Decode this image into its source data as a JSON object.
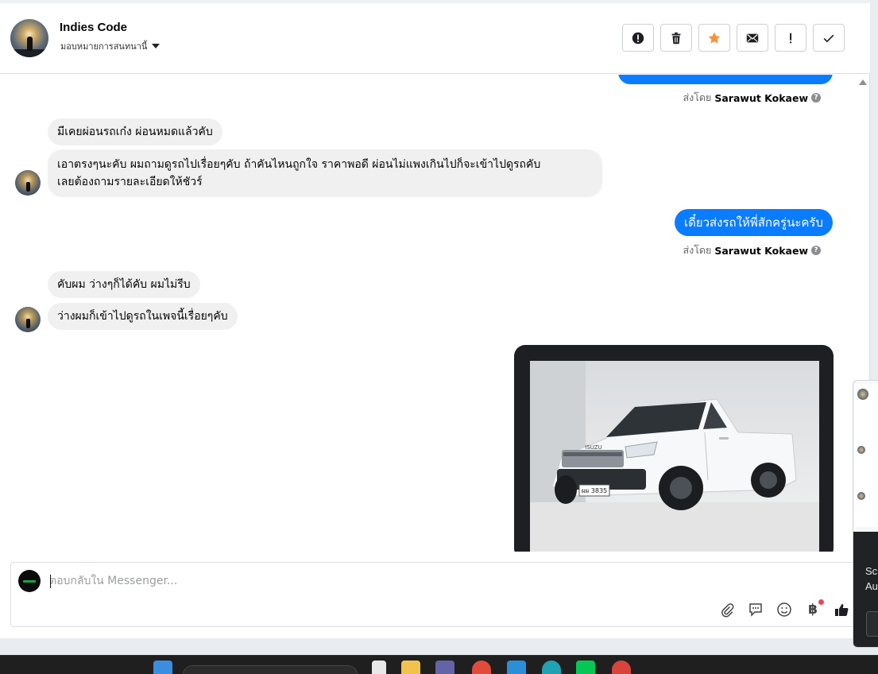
{
  "header": {
    "contact_name": "Indies Code",
    "assign_label": "มอบหมายการสนทนานี้",
    "actions": [
      {
        "id": "spam",
        "icon": "alert-circle-icon"
      },
      {
        "id": "delete",
        "icon": "trash-icon"
      },
      {
        "id": "star",
        "icon": "star-icon",
        "color": "#f7923a"
      },
      {
        "id": "unread",
        "icon": "envelope-icon"
      },
      {
        "id": "important",
        "icon": "exclamation-icon"
      },
      {
        "id": "done",
        "icon": "check-icon"
      }
    ]
  },
  "messages": {
    "sent_by_prefix": "ส่งโดย",
    "sender_name": "Sarawut Kokaew",
    "m1": "มีเคยผ่อนรถเก๋ง  ผ่อนหมดแล้วคับ",
    "m2_line1": "เอาตรงๆนะคับ  ผมถามดูรถไปเรื่อยๆคับ ถ้าคันไหนถูกใจ  ราคาพอดี ผ่อนไม่แพงเกินไปก็จะเข้าไปดูรถคับ",
    "m2_line2": "เลยต้องถามรายละเอียดให้ชัวร์",
    "m3": "เดี๋ยวส่งรถให้พี่สักครู่นะครับ",
    "m4": "คับผม ว่างๆก็ได้คับ  ผมไม่รีบ",
    "m5": "ว่างผมก็เข้าไปดูรถในเพจนี้เรื่อยๆคับ",
    "plate": "ผผ 3835",
    "car_brand": "ISUZU"
  },
  "reply": {
    "placeholder": "ตอบกลับใน Messenger...",
    "baht_symbol": "฿"
  },
  "popup": {
    "text1": "Sc",
    "text2": "Au"
  },
  "colors": {
    "outgoing_bubble": "#0a7cff",
    "incoming_bubble": "#f0f0f0",
    "star": "#f7923a",
    "notification_dot": "#e8465d"
  }
}
